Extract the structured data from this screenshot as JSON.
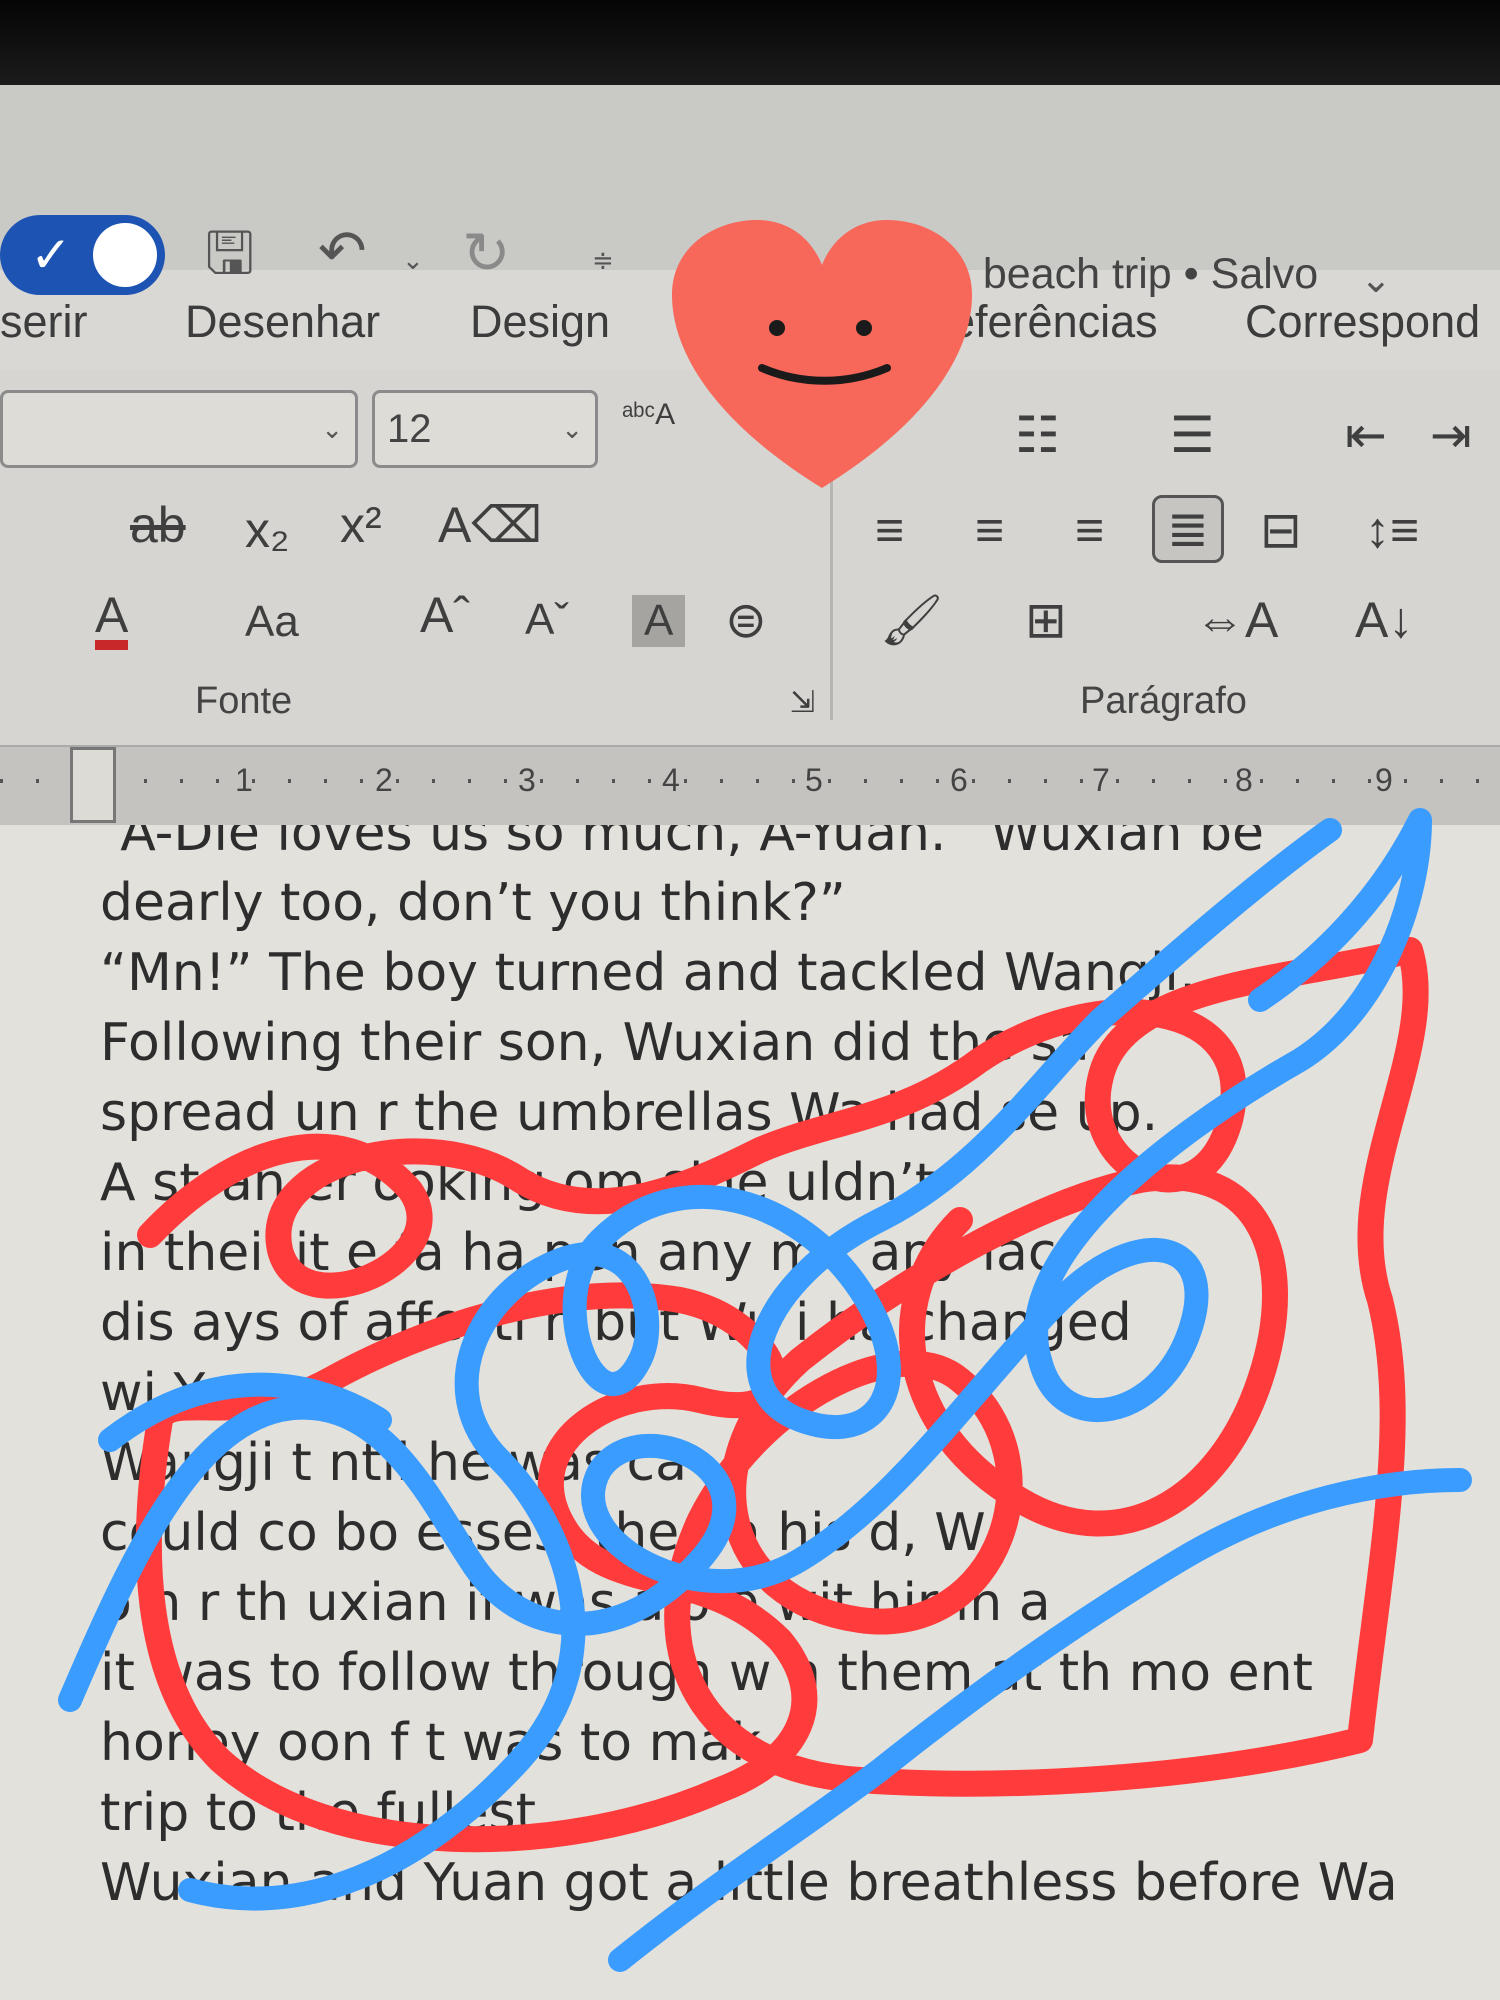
{
  "title_bar": {
    "document_title": "WangXian 9 - beach trip • Salvo"
  },
  "tabs": [
    "serir",
    "Desenhar",
    "Design",
    "eferências",
    "Correspond"
  ],
  "ribbon": {
    "font_size": "12",
    "group_font": "Fonte",
    "group_paragraph": "Parágrafo"
  },
  "ruler": [
    "1",
    "2",
    "3",
    "4",
    "5",
    "6",
    "7",
    "8",
    "9"
  ],
  "document_lines": [
    "“A-Die loves us so much, A-Yuan.” Wuxian be",
    "dearly too, don’t you think?”",
    "“Mn!” The boy turned and tackled Wangji, ",
    "Following their son, Wuxian did the sa",
    "spread un  r the umbrellas Wa  had se  up.",
    "A stran  er  ooking  om  side  uldn’t",
    "in  thei  lit  e fa     ha  pen any  m  , any  lac",
    "dis  ays of affecti  n     but Wu  i  ha  changed",
    "wi  Yuan.",
    "Wangji t             ntil he was  ca",
    "could co   bo   esses.   the ba   his   d, W",
    "o h  r th       uxian if   was alo  e wit  hir  in a",
    "it was to follow through w  h them at th  mo  ent",
    "honey  oon f     t was to mak",
    "trip to the fullest.",
    "Wuxian and Yuan got a little breathless before Wa"
  ],
  "colors": {
    "toggle_blue": "#1d54b4",
    "scribble_red": "#ff3b3b",
    "scribble_blue": "#3a9cff",
    "sticker_heart": "#f7675a"
  }
}
